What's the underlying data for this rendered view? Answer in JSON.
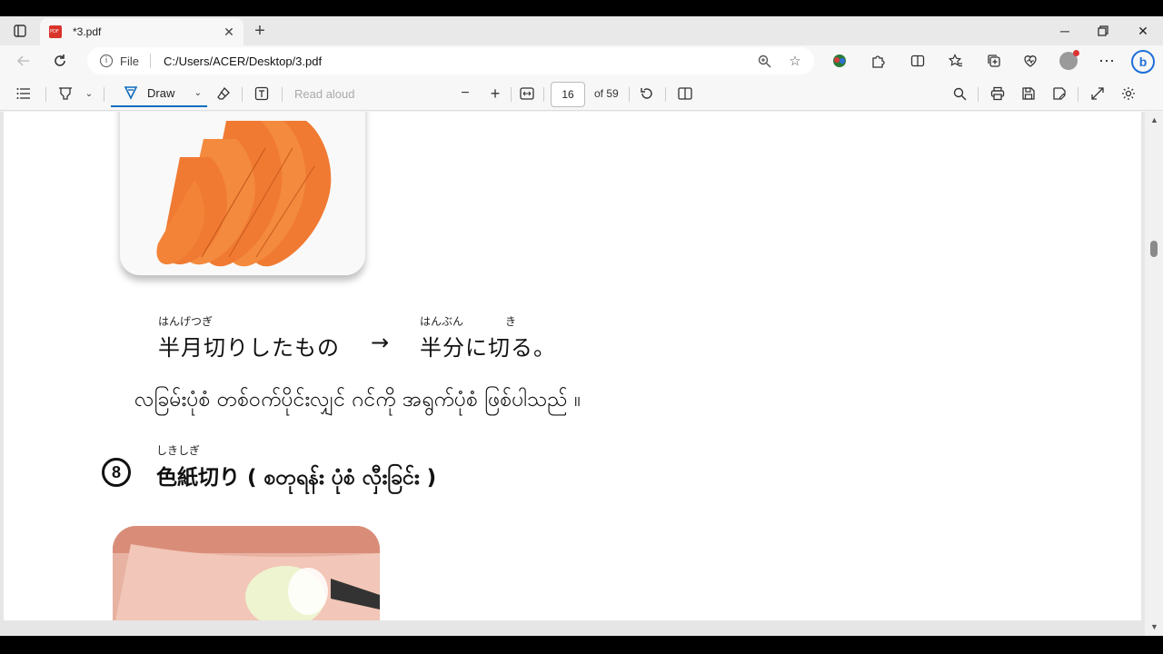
{
  "tab": {
    "title": "*3.pdf",
    "favicon": "pdf-icon"
  },
  "address": {
    "scheme": "File",
    "url": "C:/Users/ACER/Desktop/3.pdf"
  },
  "pdf_toolbar": {
    "draw_label": "Draw",
    "read_aloud_label": "Read aloud",
    "page_number": "16",
    "page_of": "of 59"
  },
  "document": {
    "line1_ruby_a": "はんげつぎ",
    "line1_ruby_b": "はんぶん",
    "line1_ruby_c": "き",
    "line1_left": "半月切りしたもの",
    "arrow": "→",
    "line1_right": "半分に切る。",
    "line2_burmese": "လခြမ်းပုံစံ တစ်ဝက်ပိုင်းလျှင် ဂင်ကို အရွက်ပုံစံ ဖြစ်ပါသည် ။",
    "heading_ruby": "しきしぎ",
    "heading_number": "8",
    "heading_text": "色紙切り ( စတုရန်း ပုံစံ လှီးခြင်း )"
  },
  "colors": {
    "accent": "#0f6cbd",
    "carrot": "#f07a32"
  }
}
